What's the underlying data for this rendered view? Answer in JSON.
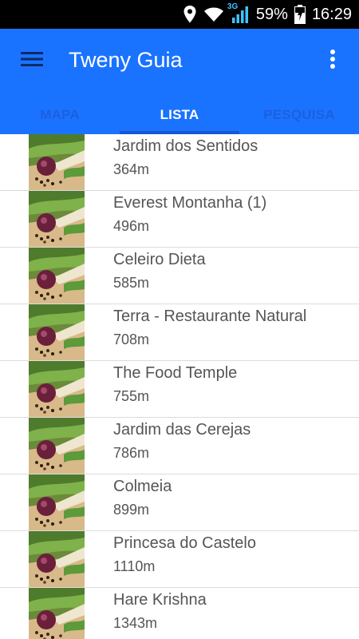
{
  "status_bar": {
    "network": "3G",
    "battery": "59%",
    "time": "16:29"
  },
  "app_bar": {
    "title": "Tweny Guia",
    "color": "#1a73ff",
    "menu_icon": "hamburger-menu-icon",
    "overflow_icon": "more-vert-icon"
  },
  "tabs": [
    {
      "label": "MAPA",
      "active": false
    },
    {
      "label": "LISTA",
      "active": true
    },
    {
      "label": "PESQUISA",
      "active": false
    }
  ],
  "places": [
    {
      "name": "Jardim dos Sentidos",
      "distance": "364m"
    },
    {
      "name": "Everest Montanha (1)",
      "distance": "496m"
    },
    {
      "name": "Celeiro Dieta",
      "distance": "585m"
    },
    {
      "name": "Terra - Restaurante Natural",
      "distance": "708m"
    },
    {
      "name": "The Food Temple",
      "distance": "755m"
    },
    {
      "name": "Jardim das Cerejas",
      "distance": "786m"
    },
    {
      "name": "Colmeia",
      "distance": "899m"
    },
    {
      "name": "Princesa do Castelo",
      "distance": "1110m"
    },
    {
      "name": "Hare Krishna",
      "distance": "1343m"
    }
  ]
}
